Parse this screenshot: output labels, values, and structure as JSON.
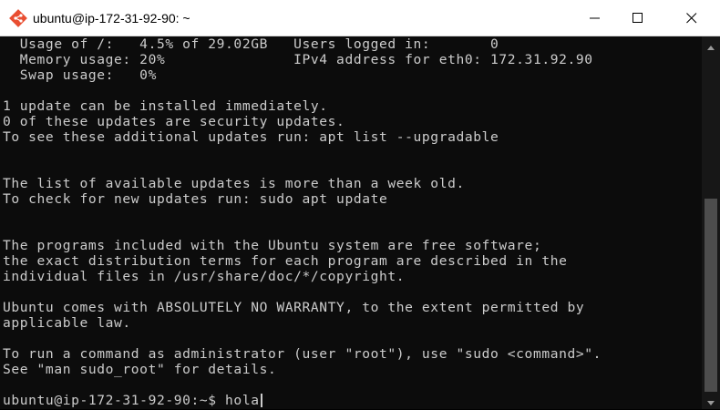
{
  "window": {
    "title": "ubuntu@ip-172-31-92-90: ~",
    "app_icon": "git-bash-diamond-icon",
    "controls": [
      "minimize-icon",
      "maximize-icon",
      "close-icon"
    ],
    "accent": "#e94e31"
  },
  "terminal": {
    "lines": [
      "  Usage of /:   4.5% of 29.02GB   Users logged in:       0",
      "  Memory usage: 20%               IPv4 address for eth0: 172.31.92.90",
      "  Swap usage:   0%",
      "",
      "1 update can be installed immediately.",
      "0 of these updates are security updates.",
      "To see these additional updates run: apt list --upgradable",
      "",
      "",
      "The list of available updates is more than a week old.",
      "To check for new updates run: sudo apt update",
      "",
      "",
      "The programs included with the Ubuntu system are free software;",
      "the exact distribution terms for each program are described in the",
      "individual files in /usr/share/doc/*/copyright.",
      "",
      "Ubuntu comes with ABSOLUTELY NO WARRANTY, to the extent permitted by",
      "applicable law.",
      "",
      "To run a command as administrator (user \"root\"), use \"sudo <command>\".",
      "See \"man sudo_root\" for details.",
      ""
    ],
    "prompt": "ubuntu@ip-172-31-92-90:~$ ",
    "input": "hola",
    "text_color": "#cccccc",
    "background": "#0c0c0c"
  },
  "scrollbar": {
    "up_icon": "scroll-up-arrow-icon",
    "down_icon": "scroll-down-arrow-icon"
  }
}
